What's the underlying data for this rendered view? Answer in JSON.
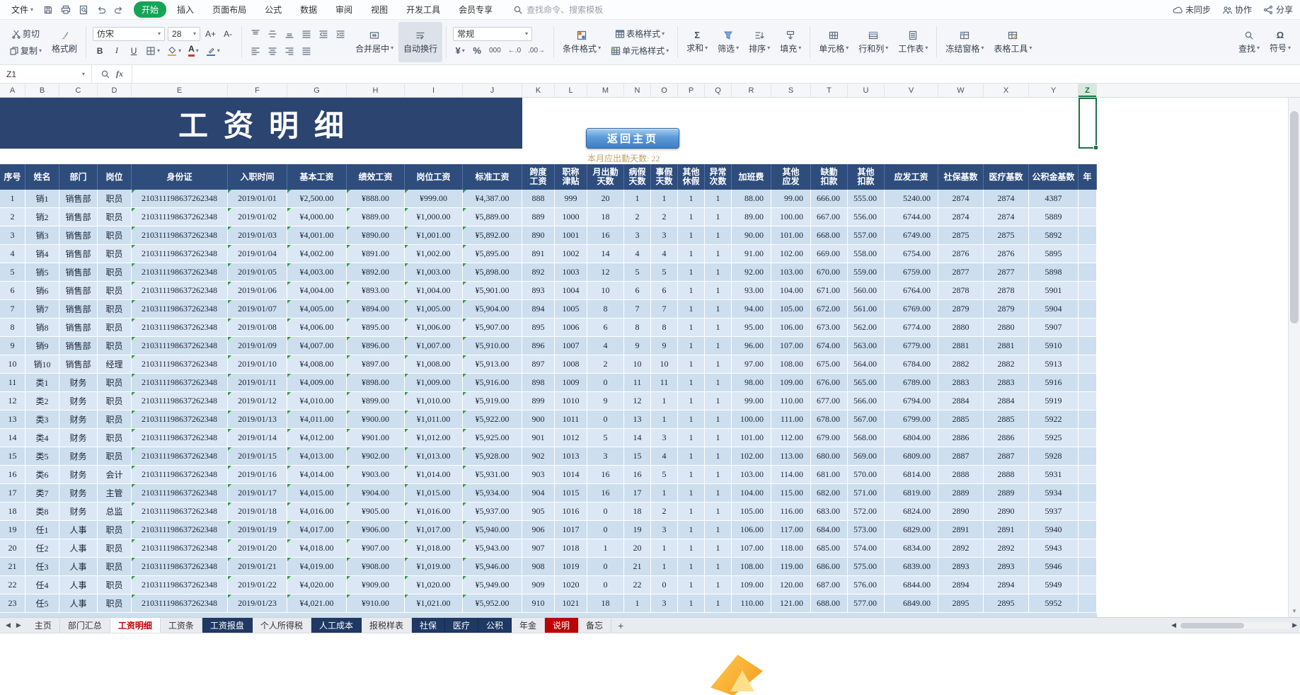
{
  "glyphs": {
    "caret": "▾",
    "up": "▲",
    "down": "▼",
    "left": "◀",
    "right": "▶",
    "plus": "+"
  },
  "menu": {
    "file": "文件",
    "quick_icons": [
      "save",
      "print",
      "print-preview",
      "undo",
      "redo"
    ],
    "tabs": [
      "开始",
      "插入",
      "页面布局",
      "公式",
      "数据",
      "审阅",
      "视图",
      "开发工具",
      "会员专享"
    ],
    "active_tab": "开始",
    "search": "查找命令、搜索模板",
    "right_items": [
      {
        "icon": "cloud",
        "label": "未同步"
      },
      {
        "icon": "people",
        "label": "协作"
      },
      {
        "icon": "share",
        "label": "分享"
      }
    ]
  },
  "ribbon": {
    "cut": "剪切",
    "copy": "复制",
    "painter": "格式刷",
    "font_family": "仿宋",
    "font_size": "28",
    "font_increase": "A+",
    "font_decrease": "A-",
    "bold": "B",
    "italic": "I",
    "underline": "U",
    "font_color": "A",
    "align_row1": [
      "align-top",
      "align-middle",
      "align-bottom",
      "align-justify",
      "indent-decrease",
      "indent-increase"
    ],
    "align_row2": [
      "align-left",
      "align-center",
      "align-right",
      "align-distribute"
    ],
    "merge_center": "合并居中",
    "wrap_text": "自动换行",
    "number_format": "常规",
    "currency": "¥",
    "percent": "%",
    "thousand": "000",
    "dec_inc": "←.0",
    "dec_dec": ".00→",
    "conditional_format": "条件格式",
    "table_style": "表格样式",
    "cell_style": "单元格样式",
    "group_edit": [
      {
        "icon": "sigma",
        "label": "求和"
      },
      {
        "icon": "funnel",
        "label": "筛选"
      },
      {
        "icon": "sort",
        "label": "排序"
      },
      {
        "icon": "fill-down",
        "label": "填充"
      }
    ],
    "group_cells": [
      {
        "icon": "cells",
        "label": "单元格"
      },
      {
        "icon": "rows-cols",
        "label": "行和列"
      },
      {
        "icon": "worksheet",
        "label": "工作表"
      }
    ],
    "group_view": [
      {
        "icon": "freeze",
        "label": "冻结窗格"
      },
      {
        "icon": "table-tools",
        "label": "表格工具"
      }
    ],
    "group_right": [
      {
        "icon": "magnifier",
        "label": "查找"
      },
      {
        "icon": "omega",
        "label": "符号"
      }
    ]
  },
  "formula_bar": {
    "name_box": "Z1",
    "fx": "fx",
    "content": ""
  },
  "sheet": {
    "selected_cell": "Z1",
    "selected_column": "Z",
    "column_letters": [
      "A",
      "B",
      "C",
      "D",
      "E",
      "F",
      "G",
      "H",
      "I",
      "J",
      "K",
      "L",
      "M",
      "N",
      "O",
      "P",
      "Q",
      "R",
      "S",
      "T",
      "U",
      "V",
      "W",
      "X",
      "Y",
      "Z"
    ],
    "banner_title": "工资明细",
    "home_button": "返回主页",
    "attendance_note": "本月应出勤天数: 22",
    "table": {
      "headers": [
        "序号",
        "姓名",
        "部门",
        "岗位",
        "身份证",
        "入职时间",
        "基本工资",
        "绩效工资",
        "岗位工资",
        "标准工资",
        "跨度\n工资",
        "职称\n津贴",
        "月出勤\n天数",
        "病假\n天数",
        "事假\n天数",
        "其他\n休假",
        "异常\n次数",
        "加班费",
        "其他\n应发",
        "缺勤\n扣款",
        "其他\n扣款",
        "应发工资",
        "社保基数",
        "医疗基数",
        "公积金基数",
        "年"
      ],
      "rows": [
        [
          "1",
          "销1",
          "销售部",
          "职员",
          "210311198637262348",
          "2019/01/01",
          "¥2,500.00",
          "¥888.00",
          "¥999.00",
          "¥4,387.00",
          "888",
          "999",
          "20",
          "1",
          "1",
          "1",
          "1",
          "88.00",
          "99.00",
          "666.00",
          "555.00",
          "5240.00",
          "2874",
          "2874",
          "4387"
        ],
        [
          "2",
          "销2",
          "销售部",
          "职员",
          "210311198637262348",
          "2019/01/02",
          "¥4,000.00",
          "¥889.00",
          "¥1,000.00",
          "¥5,889.00",
          "889",
          "1000",
          "18",
          "2",
          "2",
          "1",
          "1",
          "89.00",
          "100.00",
          "667.00",
          "556.00",
          "6744.00",
          "2874",
          "2874",
          "5889"
        ],
        [
          "3",
          "销3",
          "销售部",
          "职员",
          "210311198637262348",
          "2019/01/03",
          "¥4,001.00",
          "¥890.00",
          "¥1,001.00",
          "¥5,892.00",
          "890",
          "1001",
          "16",
          "3",
          "3",
          "1",
          "1",
          "90.00",
          "101.00",
          "668.00",
          "557.00",
          "6749.00",
          "2875",
          "2875",
          "5892"
        ],
        [
          "4",
          "销4",
          "销售部",
          "职员",
          "210311198637262348",
          "2019/01/04",
          "¥4,002.00",
          "¥891.00",
          "¥1,002.00",
          "¥5,895.00",
          "891",
          "1002",
          "14",
          "4",
          "4",
          "1",
          "1",
          "91.00",
          "102.00",
          "669.00",
          "558.00",
          "6754.00",
          "2876",
          "2876",
          "5895"
        ],
        [
          "5",
          "销5",
          "销售部",
          "职员",
          "210311198637262348",
          "2019/01/05",
          "¥4,003.00",
          "¥892.00",
          "¥1,003.00",
          "¥5,898.00",
          "892",
          "1003",
          "12",
          "5",
          "5",
          "1",
          "1",
          "92.00",
          "103.00",
          "670.00",
          "559.00",
          "6759.00",
          "2877",
          "2877",
          "5898"
        ],
        [
          "6",
          "销6",
          "销售部",
          "职员",
          "210311198637262348",
          "2019/01/06",
          "¥4,004.00",
          "¥893.00",
          "¥1,004.00",
          "¥5,901.00",
          "893",
          "1004",
          "10",
          "6",
          "6",
          "1",
          "1",
          "93.00",
          "104.00",
          "671.00",
          "560.00",
          "6764.00",
          "2878",
          "2878",
          "5901"
        ],
        [
          "7",
          "销7",
          "销售部",
          "职员",
          "210311198637262348",
          "2019/01/07",
          "¥4,005.00",
          "¥894.00",
          "¥1,005.00",
          "¥5,904.00",
          "894",
          "1005",
          "8",
          "7",
          "7",
          "1",
          "1",
          "94.00",
          "105.00",
          "672.00",
          "561.00",
          "6769.00",
          "2879",
          "2879",
          "5904"
        ],
        [
          "8",
          "销8",
          "销售部",
          "职员",
          "210311198637262348",
          "2019/01/08",
          "¥4,006.00",
          "¥895.00",
          "¥1,006.00",
          "¥5,907.00",
          "895",
          "1006",
          "6",
          "8",
          "8",
          "1",
          "1",
          "95.00",
          "106.00",
          "673.00",
          "562.00",
          "6774.00",
          "2880",
          "2880",
          "5907"
        ],
        [
          "9",
          "销9",
          "销售部",
          "职员",
          "210311198637262348",
          "2019/01/09",
          "¥4,007.00",
          "¥896.00",
          "¥1,007.00",
          "¥5,910.00",
          "896",
          "1007",
          "4",
          "9",
          "9",
          "1",
          "1",
          "96.00",
          "107.00",
          "674.00",
          "563.00",
          "6779.00",
          "2881",
          "2881",
          "5910"
        ],
        [
          "10",
          "销10",
          "销售部",
          "经理",
          "210311198637262348",
          "2019/01/10",
          "¥4,008.00",
          "¥897.00",
          "¥1,008.00",
          "¥5,913.00",
          "897",
          "1008",
          "2",
          "10",
          "10",
          "1",
          "1",
          "97.00",
          "108.00",
          "675.00",
          "564.00",
          "6784.00",
          "2882",
          "2882",
          "5913"
        ],
        [
          "11",
          "类1",
          "财务",
          "职员",
          "210311198637262348",
          "2019/01/11",
          "¥4,009.00",
          "¥898.00",
          "¥1,009.00",
          "¥5,916.00",
          "898",
          "1009",
          "0",
          "11",
          "11",
          "1",
          "1",
          "98.00",
          "109.00",
          "676.00",
          "565.00",
          "6789.00",
          "2883",
          "2883",
          "5916"
        ],
        [
          "12",
          "类2",
          "财务",
          "职员",
          "210311198637262348",
          "2019/01/12",
          "¥4,010.00",
          "¥899.00",
          "¥1,010.00",
          "¥5,919.00",
          "899",
          "1010",
          "9",
          "12",
          "1",
          "1",
          "1",
          "99.00",
          "110.00",
          "677.00",
          "566.00",
          "6794.00",
          "2884",
          "2884",
          "5919"
        ],
        [
          "13",
          "类3",
          "财务",
          "职员",
          "210311198637262348",
          "2019/01/13",
          "¥4,011.00",
          "¥900.00",
          "¥1,011.00",
          "¥5,922.00",
          "900",
          "1011",
          "0",
          "13",
          "1",
          "1",
          "1",
          "100.00",
          "111.00",
          "678.00",
          "567.00",
          "6799.00",
          "2885",
          "2885",
          "5922"
        ],
        [
          "14",
          "类4",
          "财务",
          "职员",
          "210311198637262348",
          "2019/01/14",
          "¥4,012.00",
          "¥901.00",
          "¥1,012.00",
          "¥5,925.00",
          "901",
          "1012",
          "5",
          "14",
          "3",
          "1",
          "1",
          "101.00",
          "112.00",
          "679.00",
          "568.00",
          "6804.00",
          "2886",
          "2886",
          "5925"
        ],
        [
          "15",
          "类5",
          "财务",
          "职员",
          "210311198637262348",
          "2019/01/15",
          "¥4,013.00",
          "¥902.00",
          "¥1,013.00",
          "¥5,928.00",
          "902",
          "1013",
          "3",
          "15",
          "4",
          "1",
          "1",
          "102.00",
          "113.00",
          "680.00",
          "569.00",
          "6809.00",
          "2887",
          "2887",
          "5928"
        ],
        [
          "16",
          "类6",
          "财务",
          "会计",
          "210311198637262348",
          "2019/01/16",
          "¥4,014.00",
          "¥903.00",
          "¥1,014.00",
          "¥5,931.00",
          "903",
          "1014",
          "16",
          "16",
          "5",
          "1",
          "1",
          "103.00",
          "114.00",
          "681.00",
          "570.00",
          "6814.00",
          "2888",
          "2888",
          "5931"
        ],
        [
          "17",
          "类7",
          "财务",
          "主管",
          "210311198637262348",
          "2019/01/17",
          "¥4,015.00",
          "¥904.00",
          "¥1,015.00",
          "¥5,934.00",
          "904",
          "1015",
          "16",
          "17",
          "1",
          "1",
          "1",
          "104.00",
          "115.00",
          "682.00",
          "571.00",
          "6819.00",
          "2889",
          "2889",
          "5934"
        ],
        [
          "18",
          "类8",
          "财务",
          "总监",
          "210311198637262348",
          "2019/01/18",
          "¥4,016.00",
          "¥905.00",
          "¥1,016.00",
          "¥5,937.00",
          "905",
          "1016",
          "0",
          "18",
          "2",
          "1",
          "1",
          "105.00",
          "116.00",
          "683.00",
          "572.00",
          "6824.00",
          "2890",
          "2890",
          "5937"
        ],
        [
          "19",
          "任1",
          "人事",
          "职员",
          "210311198637262348",
          "2019/01/19",
          "¥4,017.00",
          "¥906.00",
          "¥1,017.00",
          "¥5,940.00",
          "906",
          "1017",
          "0",
          "19",
          "3",
          "1",
          "1",
          "106.00",
          "117.00",
          "684.00",
          "573.00",
          "6829.00",
          "2891",
          "2891",
          "5940"
        ],
        [
          "20",
          "任2",
          "人事",
          "职员",
          "210311198637262348",
          "2019/01/20",
          "¥4,018.00",
          "¥907.00",
          "¥1,018.00",
          "¥5,943.00",
          "907",
          "1018",
          "1",
          "20",
          "1",
          "1",
          "1",
          "107.00",
          "118.00",
          "685.00",
          "574.00",
          "6834.00",
          "2892",
          "2892",
          "5943"
        ],
        [
          "21",
          "任3",
          "人事",
          "职员",
          "210311198637262348",
          "2019/01/21",
          "¥4,019.00",
          "¥908.00",
          "¥1,019.00",
          "¥5,946.00",
          "908",
          "1019",
          "0",
          "21",
          "1",
          "1",
          "1",
          "108.00",
          "119.00",
          "686.00",
          "575.00",
          "6839.00",
          "2893",
          "2893",
          "5946"
        ],
        [
          "22",
          "任4",
          "人事",
          "职员",
          "210311198637262348",
          "2019/01/22",
          "¥4,020.00",
          "¥909.00",
          "¥1,020.00",
          "¥5,949.00",
          "909",
          "1020",
          "0",
          "22",
          "0",
          "1",
          "1",
          "109.00",
          "120.00",
          "687.00",
          "576.00",
          "6844.00",
          "2894",
          "2894",
          "5949"
        ],
        [
          "23",
          "任5",
          "人事",
          "职员",
          "210311198637262348",
          "2019/01/23",
          "¥4,021.00",
          "¥910.00",
          "¥1,021.00",
          "¥5,952.00",
          "910",
          "1021",
          "18",
          "1",
          "3",
          "1",
          "1",
          "110.00",
          "121.00",
          "688.00",
          "577.00",
          "6849.00",
          "2895",
          "2895",
          "5952"
        ]
      ]
    },
    "tabs": [
      {
        "label": "主页",
        "style": "normal"
      },
      {
        "label": "部门汇总",
        "style": "normal"
      },
      {
        "label": "工资明细",
        "style": "active"
      },
      {
        "label": "工资条",
        "style": "normal"
      },
      {
        "label": "工资报盘",
        "style": "dark"
      },
      {
        "label": "个人所得税",
        "style": "normal"
      },
      {
        "label": "人工成本",
        "style": "dark"
      },
      {
        "label": "报税样表",
        "style": "normal"
      },
      {
        "label": "社保",
        "style": "dark"
      },
      {
        "label": "医疗",
        "style": "dark"
      },
      {
        "label": "公积",
        "style": "dark"
      },
      {
        "label": "年金",
        "style": "normal"
      },
      {
        "label": "说明",
        "style": "red"
      },
      {
        "label": "备忘",
        "style": "normal"
      }
    ]
  },
  "colors": {
    "banner_bg": "#2b4470",
    "table_header_bg": "#2e4d7d",
    "row_odd": "#cddeee",
    "row_even": "#dbe7f4",
    "wps_green": "#16a457",
    "selection_green": "#217346",
    "tab_dark": "#1f3864",
    "tab_red": "#c00000",
    "active_tab_text": "#c00000",
    "note_color": "#bfa265",
    "home_button_blue": "#3f7ec2"
  }
}
